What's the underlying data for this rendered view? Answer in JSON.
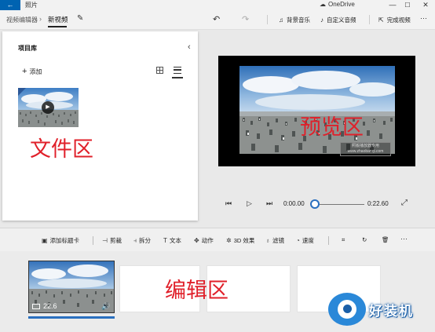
{
  "window": {
    "back_icon": "arrow-left-icon",
    "title": "照片",
    "onedrive_label": "OneDrive",
    "minimize": "—",
    "maximize": "☐",
    "close": "✕"
  },
  "toolbar": {
    "breadcrumb_parent": "视频编辑器",
    "breadcrumb_sep": "›",
    "breadcrumb_current": "新视频",
    "undo_icon": "undo-icon",
    "redo_icon": "redo-icon",
    "music_label": "背景音乐",
    "custom_audio_label": "自定义音频",
    "finish_label": "完成视频",
    "more": "···"
  },
  "library": {
    "title": "项目库",
    "add_label": "添加",
    "annotation": "文件区"
  },
  "preview": {
    "annotation": "预览区",
    "watermark_line1": "照搬播放器专用",
    "watermark_line2": "www.zhaobanqi.com"
  },
  "playback": {
    "current_time": "0:00.00",
    "total_time": "0:22.60",
    "progress": 0
  },
  "edit_toolbar": {
    "title_card": "添加标题卡",
    "trim": "剪裁",
    "split": "拆分",
    "text": "文本",
    "motion": "动作",
    "effects_3d": "3D 效果",
    "filters": "滤镜",
    "speed": "速度",
    "more": "···"
  },
  "storyboard": {
    "clip_duration": "22.6",
    "annotation": "编辑区"
  },
  "logo": {
    "text": "好装机"
  },
  "colors": {
    "accent": "#0063b1",
    "annotation": "#e0202a",
    "timeline": "#2a6fbf"
  }
}
